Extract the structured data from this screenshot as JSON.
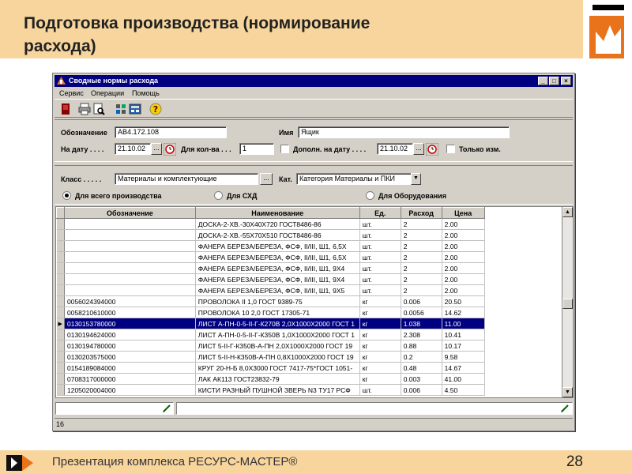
{
  "slide": {
    "title": "Подготовка производства (нормирование\nрасхода)",
    "footer_text": "Презентация комплекса РЕСУРС-МАСТЕР®",
    "page_number": "28"
  },
  "colors": {
    "slide_band": "#f7d59d",
    "logo_orange": "#e8731a",
    "titlebar_blue": "#000080",
    "window_gray": "#d4d0c8",
    "selection_blue": "#000080"
  },
  "window": {
    "title": "Сводные нормы расхода",
    "controls": [
      "_",
      "□",
      "×"
    ],
    "menu": [
      "Сервис",
      "Операции",
      "Помощь"
    ],
    "toolbar_icons": [
      "exit-icon",
      "print-icon",
      "preview-icon",
      "tools-icon",
      "calculator-icon",
      "help-icon"
    ]
  },
  "filters": {
    "designation_label": "Обозначение",
    "designation_value": "АВ4.172.108",
    "name_label": "Имя",
    "name_value": "Ящик",
    "date_label": "На дату . . . .",
    "date_value": "21.10.02",
    "qty_label": "Для кол-ва . . .",
    "qty_value": "1",
    "extra_date_label": "Дополн. на дату . . . .",
    "extra_date_value": "21.10.02",
    "only_changes_label": "Только изм.",
    "ellipsis": "...",
    "class_label": "Класс . . . . .",
    "class_value": "Материалы и комплектующие",
    "cat_label": "Кат.",
    "cat_value": "Категория Материалы и ПКИ",
    "radio_all": "Для всего производства",
    "radio_skhd": "Для СХД",
    "radio_equipment": "Для Оборудования",
    "selected_radio": "all"
  },
  "table": {
    "headers": [
      "Обозначение",
      "Наименование",
      "Ед.",
      "Расход",
      "Цена"
    ],
    "selected_row": 9,
    "rows": [
      [
        "",
        "ДОСКА-2-ХВ.-30Х40Х720 ГОСТ8486-86",
        "шт.",
        "2",
        "2.00"
      ],
      [
        "",
        "ДОСКА-2-ХВ.-55Х70Х510 ГОСТ8486-86",
        "шт.",
        "2",
        "2.00"
      ],
      [
        "",
        "ФАНЕРА БЕРЕЗА/БЕРЕЗА, ФСФ, II/III, Ш1, 6,5Х",
        "шт.",
        "2",
        "2.00"
      ],
      [
        "",
        "ФАНЕРА БЕРЕЗА/БЕРЕЗА, ФСФ, II/III, Ш1, 6,5Х",
        "шт.",
        "2",
        "2.00"
      ],
      [
        "",
        "ФАНЕРА БЕРЕЗА/БЕРЕЗА, ФСФ, II/III, Ш1, 9Х4",
        "шт.",
        "2",
        "2.00"
      ],
      [
        "",
        "ФАНЕРА БЕРЕЗА/БЕРЕЗА, ФСФ, II/III, Ш1, 9Х4",
        "шт.",
        "2",
        "2.00"
      ],
      [
        "",
        "ФАНЕРА БЕРЕЗА/БЕРЕЗА, ФСФ, II/III, Ш1, 9Х5",
        "шт.",
        "2",
        "2.00"
      ],
      [
        "0056024394000",
        "ПРОВОЛОКА II 1,0 ГОСТ 9389-75",
        "кг",
        "0.006",
        "20.50"
      ],
      [
        "0058210610000",
        "ПРОВОЛОКА 10 2,0 ГОСТ 17305-71",
        "кг",
        "0.0056",
        "14.62"
      ],
      [
        "0130153780000",
        "ЛИСТ А-ПН-0-5-II-Г-К270В 2,0Х1000Х2000 ГОСТ 1",
        "кг",
        "1.038",
        "11.00"
      ],
      [
        "0130194624000",
        "ЛИСТ А-ПН-0-5-II-Г-К350В 1,0Х1000Х2000 ГОСТ 1",
        "кг",
        "2.308",
        "10.41"
      ],
      [
        "0130194780000",
        "ЛИСТ 5-II-Г-К350В-А-ПН 2,0Х1000Х2000 ГОСТ 19",
        "кг",
        "0.88",
        "10.17"
      ],
      [
        "0130203575000",
        "ЛИСТ 5-II-Н-К350В-А-ПН 0,8Х1000Х2000 ГОСТ 19",
        "кг",
        "0.2",
        "9.58"
      ],
      [
        "0154189084000",
        "КРУГ 20-Н-Б 8,0Х3000 ГОСТ 7417-75*ГОСТ 1051-",
        "кг",
        "0.48",
        "14.67"
      ],
      [
        "0708317000000",
        "ЛАК АК113 ГОСТ23832-79",
        "кг",
        "0.003",
        "41.00"
      ],
      [
        "1205020004000",
        "КИСТИ РАЗНЫЙ ПУШНОЙ ЗВЕРЬ N3 ТУ17 РСФ",
        "шт.",
        "0.006",
        "4.50"
      ]
    ]
  },
  "status": {
    "count": "16"
  }
}
